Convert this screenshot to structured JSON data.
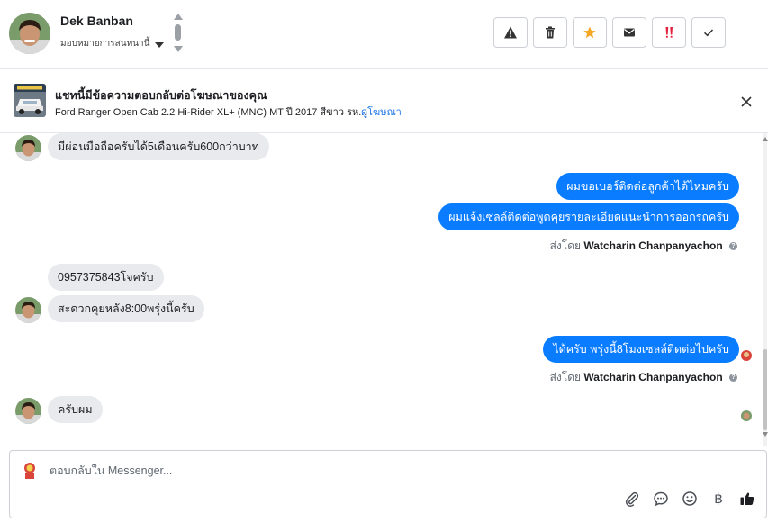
{
  "header": {
    "contact_name": "Dek Banban",
    "assign_label": "มอบหมายการสนทนานี้",
    "toolbar": [
      {
        "name": "spam-button",
        "icon": "warning-icon"
      },
      {
        "name": "delete-button",
        "icon": "trash-icon"
      },
      {
        "name": "star-button",
        "icon": "star-icon",
        "color": "#f5a623"
      },
      {
        "name": "mark-unread-button",
        "icon": "envelope-icon"
      },
      {
        "name": "follow-up-button",
        "icon": "exclamation-icon",
        "color": "#e41e3f"
      },
      {
        "name": "done-button",
        "icon": "check-icon"
      }
    ]
  },
  "ad": {
    "title": "แชทนี้มีข้อความตอบกลับต่อโฆษณาของคุณ",
    "description": "Ford Ranger Open Cab 2.2 Hi-Rider XL+ (MNC) MT ปี 2017 สีขาว รห...",
    "link_label": "ดูโฆษณา"
  },
  "messages": [
    {
      "direction": "in",
      "text": "มีผ่อนมือถือครับได้5เดือนครับ600กว่าบาท"
    },
    {
      "direction": "out",
      "text": "ผมขอเบอร์ติดต่อลูกค้าได้ไหมครับ"
    },
    {
      "direction": "out",
      "text": "ผมแจ้งเซลล์ติดต่อพูดคุยรายละเอียดแนะนำการออกรถครับ"
    },
    {
      "direction": "meta",
      "prefix": "ส่งโดย",
      "sender": "Watcharin Chanpanyachon"
    },
    {
      "direction": "in",
      "text": "0957375843โจครับ"
    },
    {
      "direction": "in",
      "text": "สะดวกคุยหลัง8:00พรุ่งนี้ครับ"
    },
    {
      "direction": "out",
      "text": "ได้ครับ พรุ่งนี้8โมงเซลล์ติดต่อไปครับ"
    },
    {
      "direction": "meta",
      "prefix": "ส่งโดย",
      "sender": "Watcharin Chanpanyachon"
    },
    {
      "direction": "in",
      "text": "ครับผม"
    }
  ],
  "composer": {
    "placeholder": "ตอบกลับใน Messenger...",
    "tools": [
      "attachment-icon",
      "saved-reply-icon",
      "emoji-icon",
      "payment-baht-icon",
      "thumbs-up-icon"
    ],
    "baht_symbol": "฿"
  },
  "colors": {
    "outgoing_bubble": "#0a7cff",
    "incoming_bubble": "#e9eaed",
    "link": "#1a73e8"
  }
}
